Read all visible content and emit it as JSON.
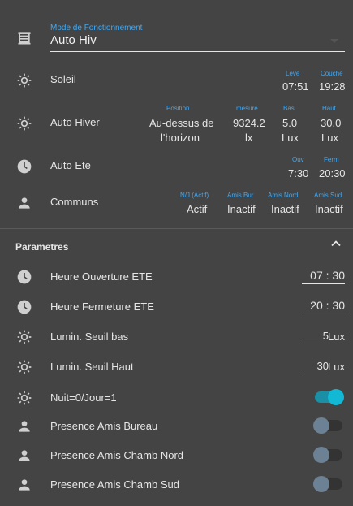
{
  "mode": {
    "caption": "Mode de Fonctionnement",
    "value": "Auto Hiv"
  },
  "soleil": {
    "label": "Soleil",
    "leve_cap": "Levé",
    "couche_cap": "Couché",
    "leve": "07:51",
    "couche": "19:28"
  },
  "auto_hiver": {
    "label": "Auto Hiver",
    "position_cap": "Position",
    "position_line1": "Au-dessus de",
    "position_line2": "l'horizon",
    "mesure_cap": "mesure",
    "mesure_value": "9324.2",
    "mesure_unit": "lx",
    "bas_cap": "Bas",
    "bas_value": "5.0",
    "bas_unit": "Lux",
    "haut_cap": "Haut",
    "haut_value": "30.0",
    "haut_unit": "Lux"
  },
  "auto_ete": {
    "label": "Auto Ete",
    "ouv_cap": "Ouv",
    "ferm_cap": "Ferm",
    "ouv": "7:30",
    "ferm": "20:30"
  },
  "communs": {
    "label": "Communs",
    "nj_cap": "N/J (Actif)",
    "nj": "Actif",
    "bur_cap": "Amis Bur",
    "bur": "Inactif",
    "nord_cap": "Amis Nord",
    "nord": "Inactif",
    "sud_cap": "Amis Sud",
    "sud": "Inactif"
  },
  "parametres": {
    "title": "Parametres",
    "heure_ouverture": {
      "label": "Heure Ouverture ETE",
      "value": "07 : 30"
    },
    "heure_fermeture": {
      "label": "Heure Fermeture ETE",
      "value": "20 : 30"
    },
    "seuil_bas": {
      "label": "Lumin. Seuil bas",
      "value": "5",
      "unit": "Lux"
    },
    "seuil_haut": {
      "label": "Lumin. Seuil Haut",
      "value": "30",
      "unit": "Lux"
    },
    "nuit_jour": {
      "label": "Nuit=0/Jour=1",
      "on": true
    },
    "amis_bureau": {
      "label": "Presence Amis Bureau",
      "on": false
    },
    "amis_nord": {
      "label": "Presence Amis Chamb Nord",
      "on": false
    },
    "amis_sud": {
      "label": "Presence Amis Chamb Sud",
      "on": false
    }
  },
  "colors": {
    "accent": "#3fa9f5",
    "toggle_on": "#13b8d4",
    "background": "#444444"
  }
}
